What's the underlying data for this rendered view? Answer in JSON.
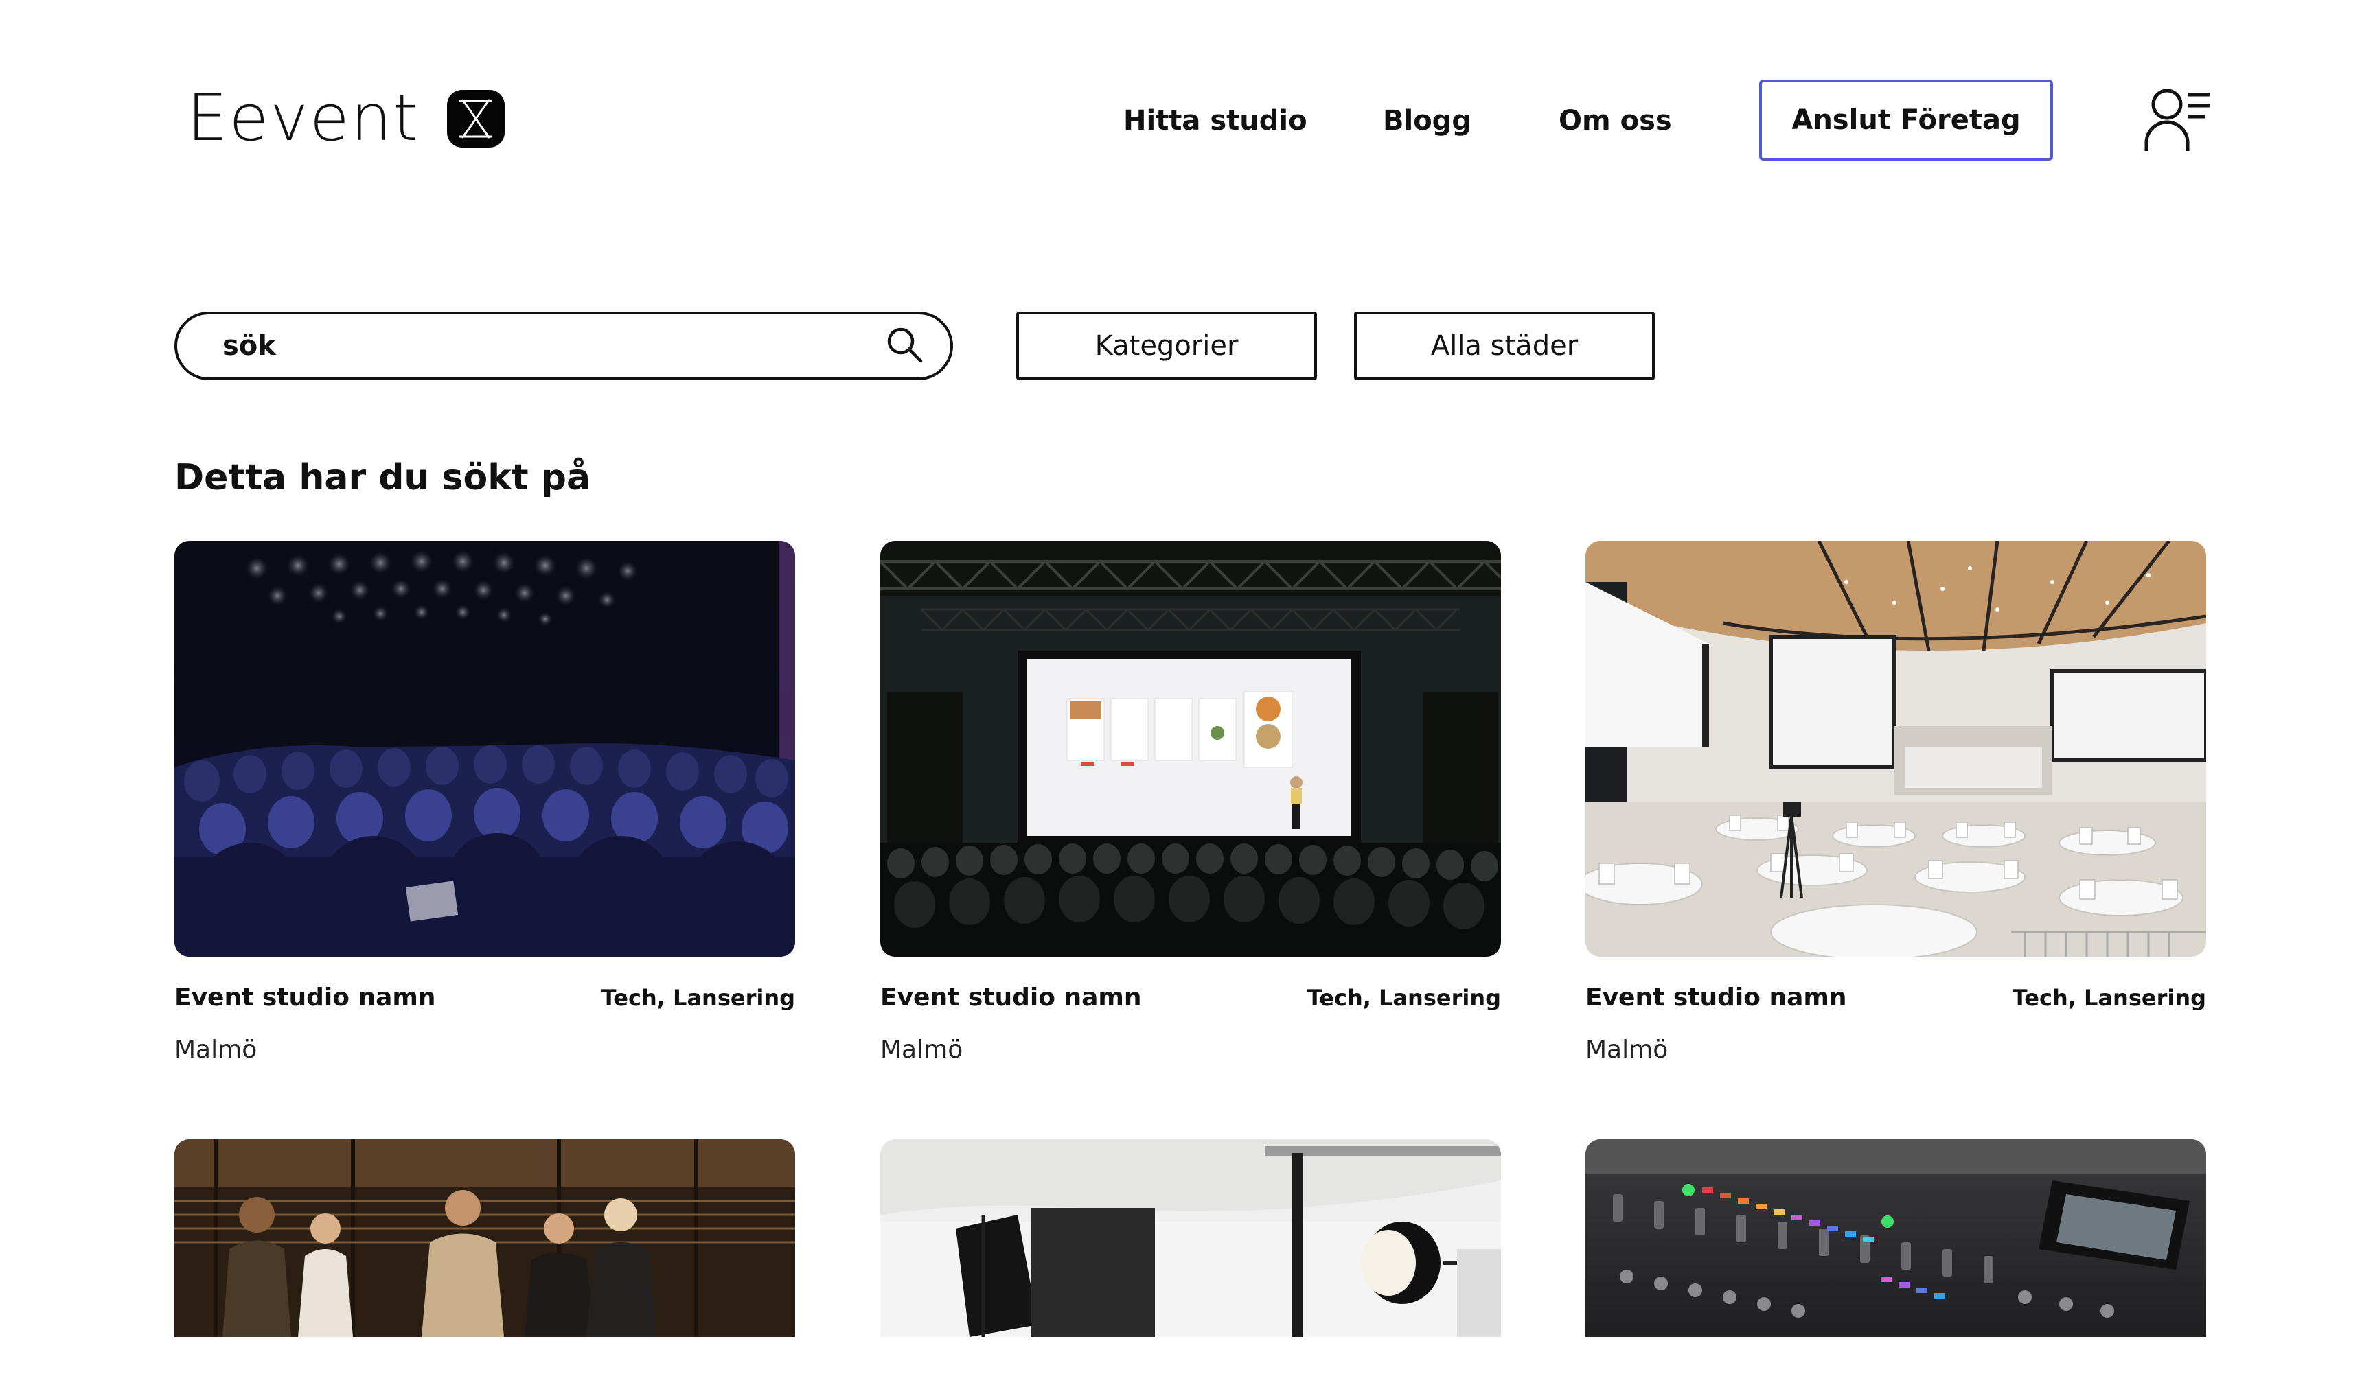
{
  "header": {
    "logo_text": "Eevent",
    "logo_mark": "X",
    "nav": {
      "find_studio": "Hitta studio",
      "blog": "Blogg",
      "about": "Om oss"
    },
    "cta_label": "Anslut Företag",
    "cta_border_color": "#5159d6",
    "user_menu_icon": "user-menu-icon"
  },
  "search": {
    "placeholder": "sök",
    "icon": "search-icon"
  },
  "filters": {
    "categories_label": "Kategorier",
    "cities_label": "Alla städer"
  },
  "section": {
    "title": "Detta har du sökt på"
  },
  "cards": [
    {
      "name": "Event studio namn",
      "tags": "Tech, Lansering",
      "city": "Malmö",
      "image": "audience-in-dark-venue"
    },
    {
      "name": "Event studio namn",
      "tags": "Tech, Lansering",
      "city": "Malmö",
      "image": "stage-presentation"
    },
    {
      "name": "Event studio namn",
      "tags": "Tech, Lansering",
      "city": "Malmö",
      "image": "conference-hall-round-tables"
    },
    {
      "image": "people-networking"
    },
    {
      "image": "photo-studio-lights"
    },
    {
      "image": "mixing-console"
    }
  ]
}
